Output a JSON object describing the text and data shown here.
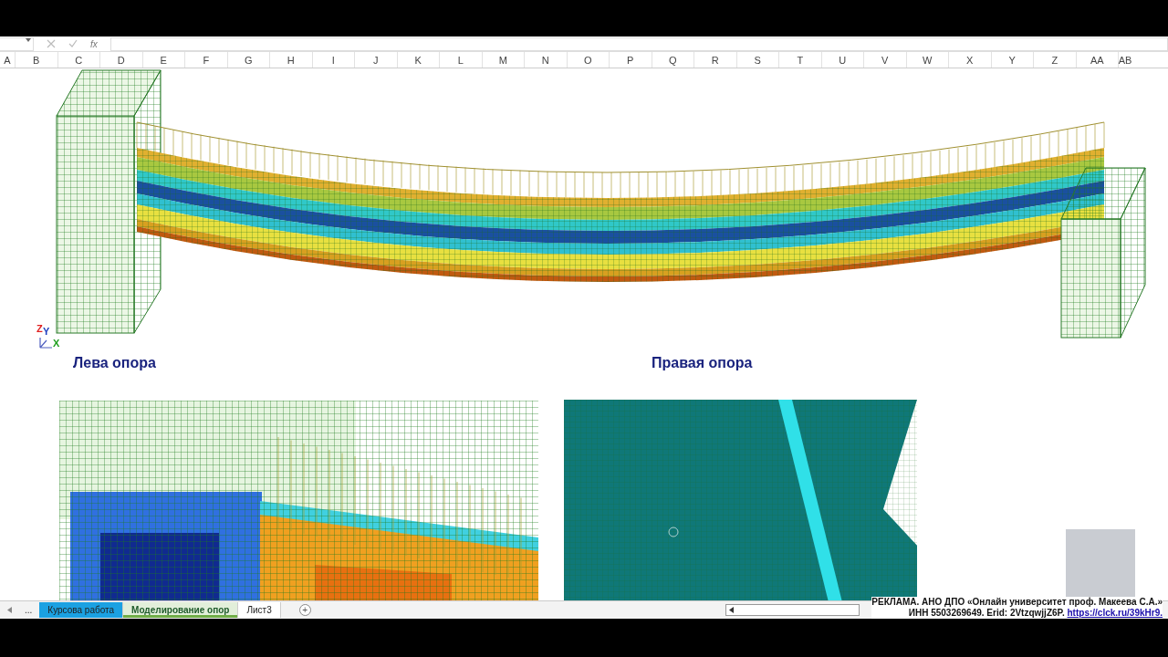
{
  "formula_bar": {
    "fx": "fx"
  },
  "columns": [
    "A",
    "B",
    "C",
    "D",
    "E",
    "F",
    "G",
    "H",
    "I",
    "J",
    "K",
    "L",
    "M",
    "N",
    "O",
    "P",
    "Q",
    "R",
    "S",
    "T",
    "U",
    "V",
    "W",
    "X",
    "Y",
    "Z",
    "AA",
    "AB"
  ],
  "axes": {
    "z": "Z",
    "y": "Y",
    "x": "X"
  },
  "captions": [
    {
      "text": "Лева опора"
    },
    {
      "text": "Правая опора"
    }
  ],
  "sheet_tabs": {
    "more": "...",
    "add": "+",
    "tabs": [
      {
        "label": "Курсова работа",
        "selected": false,
        "color": "#1ba1e2"
      },
      {
        "label": "Моделирование опор",
        "selected": true,
        "color": "#70ad47"
      },
      {
        "label": "Лист3",
        "selected": false
      }
    ]
  },
  "ad": {
    "line1": "РЕКЛАМА. АНО ДПО «Онлайн университет проф. Макеева С.А.»",
    "line2": "ИНН 5503269649. Erid: 2VtzqwjjZ6P.",
    "link": "https://clck.ru/39kHr9."
  }
}
